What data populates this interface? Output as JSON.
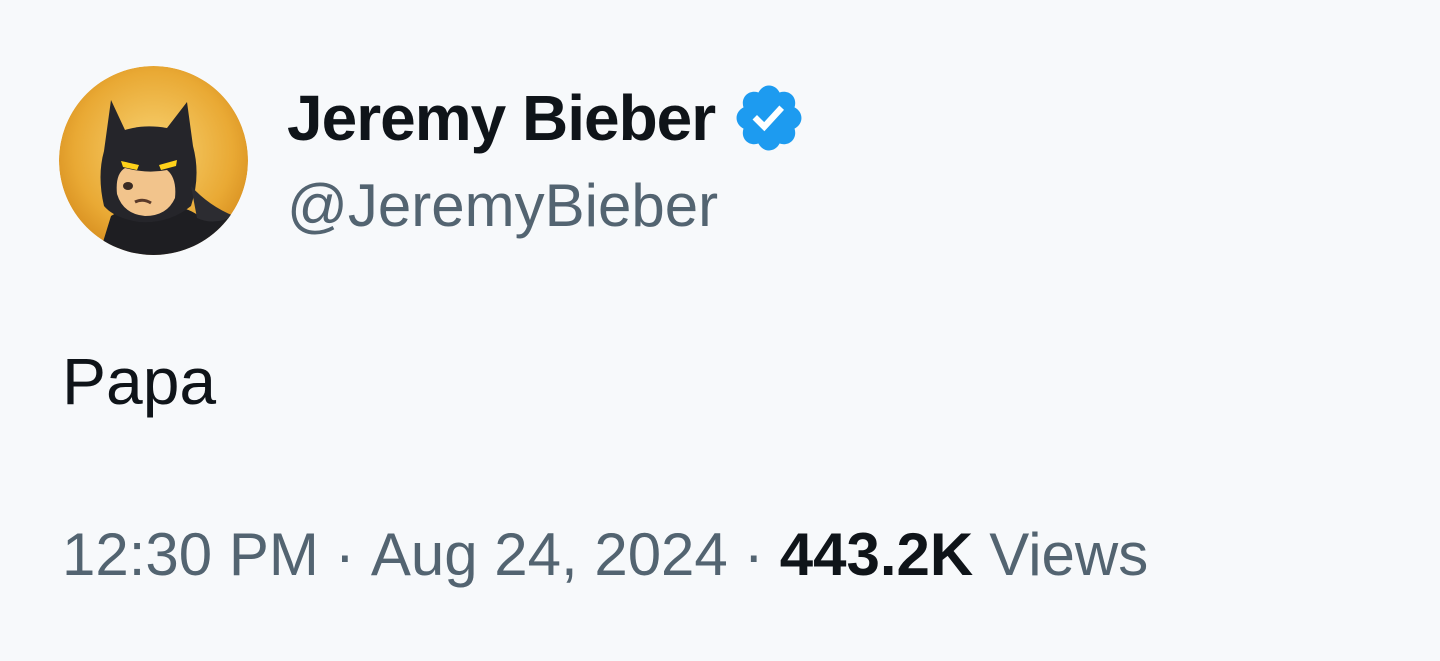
{
  "tweet": {
    "author": {
      "display_name": "Jeremy Bieber",
      "handle": "@JeremyBieber",
      "verified": true,
      "avatar_icon": "batman-cartoon-avatar"
    },
    "text": "Papa",
    "meta": {
      "time": "12:30 PM",
      "separator": "·",
      "date": "Aug 24, 2024",
      "views_count": "443.2K",
      "views_label": "Views"
    }
  },
  "colors": {
    "background": "#f7f9fb",
    "primary_text": "#0f1419",
    "secondary_text": "#536471",
    "verified_blue": "#1d9bf0",
    "avatar_gold": "#e8a52a"
  }
}
